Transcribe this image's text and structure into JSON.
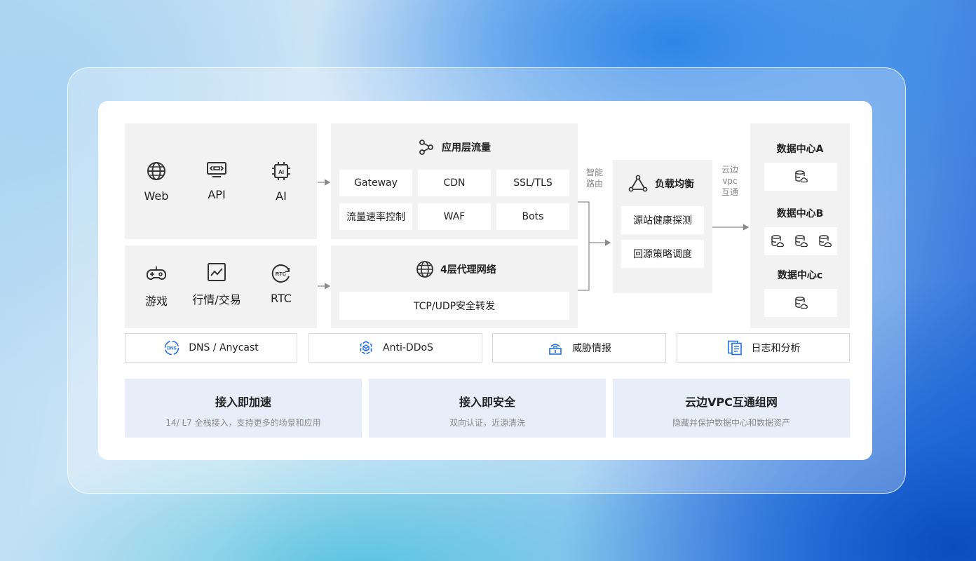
{
  "sources": {
    "top": [
      {
        "label": "Web",
        "icon": "globe-icon"
      },
      {
        "label": "API",
        "icon": "api-icon"
      },
      {
        "label": "AI",
        "icon": "chip-icon"
      }
    ],
    "bottom": [
      {
        "label": "游戏",
        "icon": "gamepad-icon"
      },
      {
        "label": "行情/交易",
        "icon": "chart-icon"
      },
      {
        "label": "RTC",
        "icon": "rtc-icon"
      }
    ]
  },
  "app_layer": {
    "title": "应用层流量",
    "icon": "flow-icon",
    "items": [
      "Gateway",
      "CDN",
      "SSL/TLS",
      "流量速率控制",
      "WAF",
      "Bots"
    ]
  },
  "l4_layer": {
    "title": "4层代理网络",
    "icon": "globe-icon",
    "item": "TCP/UDP安全转发"
  },
  "smart_routing": {
    "line1": "智能",
    "line2": "路由"
  },
  "load_balancer": {
    "title": "负载均衡",
    "icon": "triangle-nodes-icon",
    "items": [
      "源站健康探测",
      "回源策略调度"
    ]
  },
  "vpc_label": {
    "line1": "云边",
    "line2": "vpc",
    "line3": "互通"
  },
  "datacenters": [
    {
      "name": "数据中心A",
      "db_count": 1
    },
    {
      "name": "数据中心B",
      "db_count": 3
    },
    {
      "name": "数据中心c",
      "db_count": 1
    }
  ],
  "services": [
    {
      "label": "DNS / Anycast",
      "icon": "dns-icon"
    },
    {
      "label": "Anti-DDoS",
      "icon": "cube-shield-icon"
    },
    {
      "label": "威胁情报",
      "icon": "signal-icon"
    },
    {
      "label": "日志和分析",
      "icon": "document-icon"
    }
  ],
  "benefits": [
    {
      "title": "接入即加速",
      "subtitle": "14/ L7 全栈接入，支持更多的场景和应用"
    },
    {
      "title": "接入即安全",
      "subtitle": "双向认证，近源清洗"
    },
    {
      "title": "云边VPC互通组网",
      "subtitle": "隐藏并保护数据中心和数据资产"
    }
  ],
  "colors": {
    "accent": "#1f6fe5",
    "panel": "#f2f2f2",
    "benefit_bg": "#e8eef9",
    "arrow": "#8a8a8a"
  }
}
